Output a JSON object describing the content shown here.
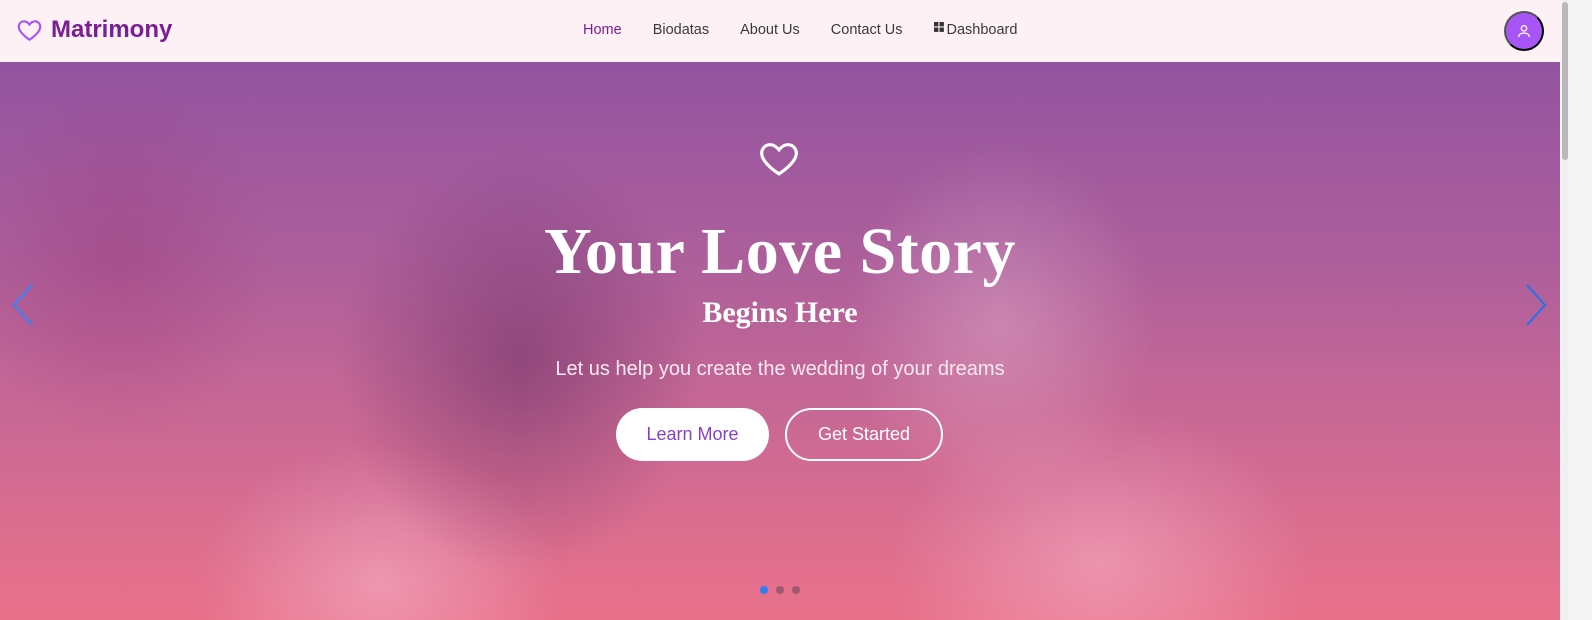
{
  "brand": {
    "name": "Matrimony",
    "icon": "heart-icon",
    "color": "#7a1e96"
  },
  "nav": {
    "items": [
      {
        "label": "Home",
        "active": true
      },
      {
        "label": "Biodatas",
        "active": false
      },
      {
        "label": "About Us",
        "active": false
      },
      {
        "label": "Contact Us",
        "active": false
      },
      {
        "label": "Dashboard",
        "active": false,
        "icon": "grid-icon"
      }
    ]
  },
  "user": {
    "icon": "user-icon",
    "color": "#a855f7"
  },
  "hero": {
    "icon": "heart-outline-icon",
    "title": "Your Love Story",
    "subtitle": "Begins Here",
    "tagline": "Let us help you create the wedding of your dreams",
    "buttons": {
      "primary": "Learn More",
      "secondary": "Get Started"
    },
    "carousel": {
      "active_slide": 1,
      "total_slides": 3,
      "indicator_color": "#2f7ff3"
    }
  }
}
